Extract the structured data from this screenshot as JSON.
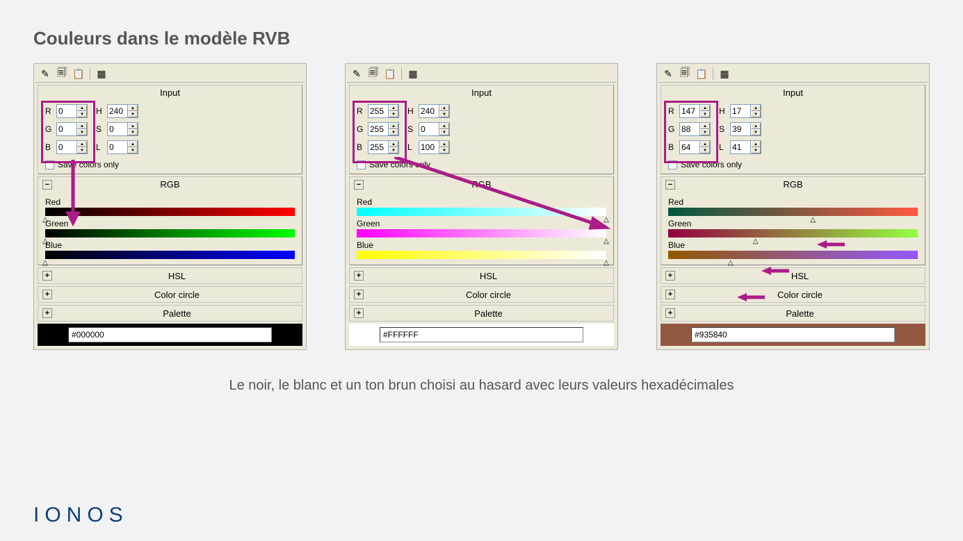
{
  "page_title": "Couleurs dans le modèle RVB",
  "caption": "Le noir, le blanc et un ton brun choisi au hasard avec leurs valeurs hexadécimales",
  "logo": "IONOS",
  "labels": {
    "input_group": "Input",
    "rgb_group": "RGB",
    "hsl_group": "HSL",
    "color_circle": "Color circle",
    "palette": "Palette",
    "save_colors": "Save colors only",
    "r": "R",
    "g": "G",
    "b": "B",
    "h": "H",
    "s": "S",
    "l": "L",
    "red_slider": "Red",
    "green_slider": "Green",
    "blue_slider": "Blue"
  },
  "panels": [
    {
      "r": "0",
      "g": "0",
      "b": "0",
      "h": "240",
      "s": "0",
      "l": "0",
      "hex": "#000000",
      "swatch_color": "#000000",
      "marker_r": 0,
      "marker_g": 0,
      "marker_b": 0,
      "grad_r_from": "#000000",
      "grad_r_to": "#ff0000",
      "grad_g_from": "#000000",
      "grad_g_to": "#00ff00",
      "grad_b_from": "#000000",
      "grad_b_to": "#0000ff"
    },
    {
      "r": "255",
      "g": "255",
      "b": "255",
      "h": "240",
      "s": "0",
      "l": "100",
      "hex": "#FFFFFF",
      "swatch_color": "#ffffff",
      "marker_r": 100,
      "marker_g": 100,
      "marker_b": 100,
      "grad_r_from": "#00ffff",
      "grad_r_to": "#ffffff",
      "grad_g_from": "#ff00ff",
      "grad_g_to": "#ffffff",
      "grad_b_from": "#ffff00",
      "grad_b_to": "#ffffff"
    },
    {
      "r": "147",
      "g": "88",
      "b": "64",
      "h": "17",
      "s": "39",
      "l": "41",
      "hex": "#935840",
      "swatch_color": "#935840",
      "marker_r": 58,
      "marker_g": 35,
      "marker_b": 25,
      "grad_r_from": "#005840",
      "grad_r_to": "#ff5840",
      "grad_g_from": "#930040",
      "grad_g_to": "#93ff40",
      "grad_b_from": "#935800",
      "grad_b_to": "#9358ff"
    }
  ]
}
